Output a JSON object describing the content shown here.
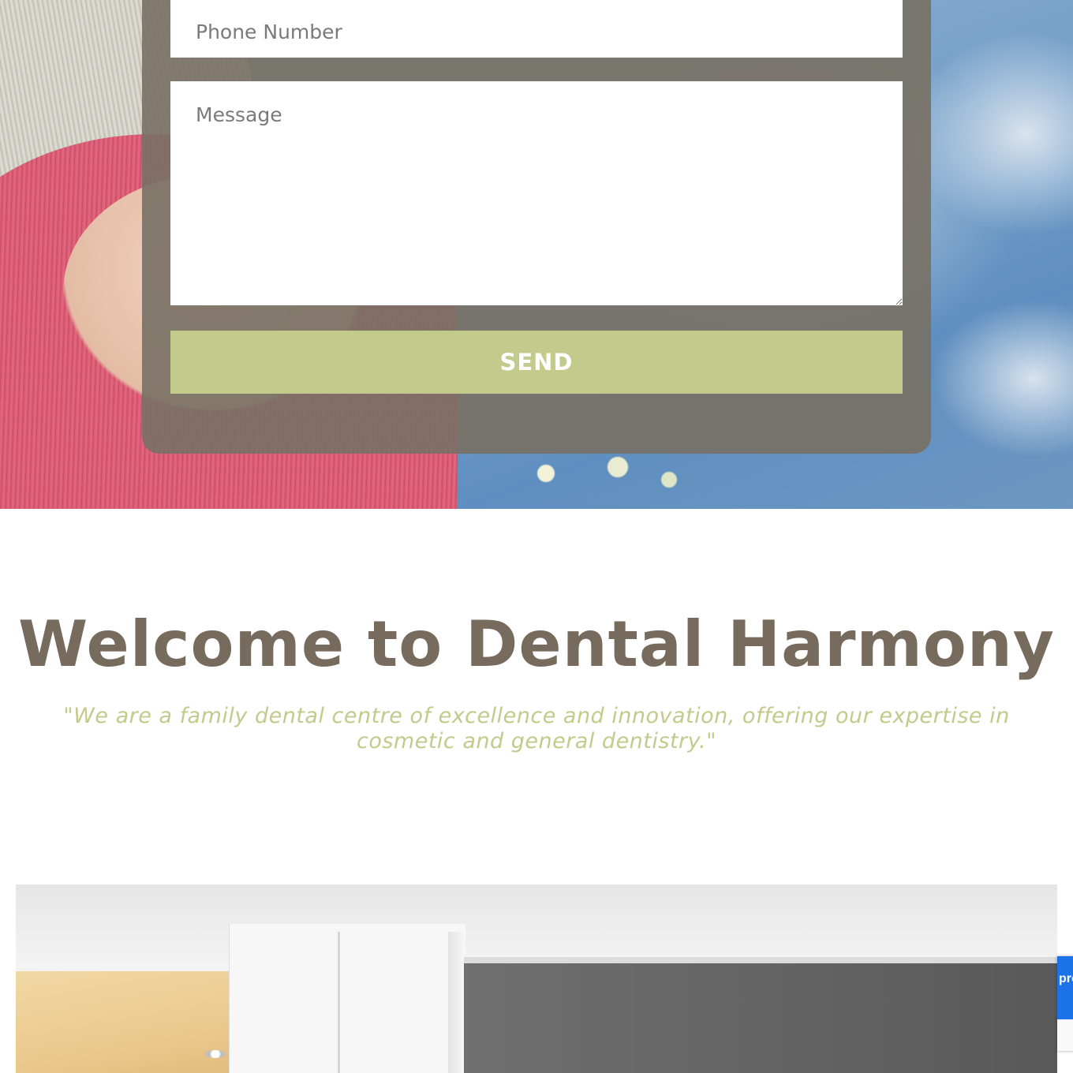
{
  "contact_form": {
    "phone_placeholder": "Phone Number",
    "message_placeholder": "Message",
    "send_label": "SEND"
  },
  "welcome": {
    "title": "Welcome to Dental Harmony",
    "quote": "\"We are a family dental centre of excellence and innovation, offering our expertise in cosmetic and general dentistry.\""
  },
  "recaptcha": {
    "partial_text": "pro"
  },
  "colors": {
    "accent_green": "#c2ca8c",
    "title_brown": "#766b5d",
    "form_panel": "#7a7064",
    "recaptcha_blue": "#1a73e8"
  }
}
